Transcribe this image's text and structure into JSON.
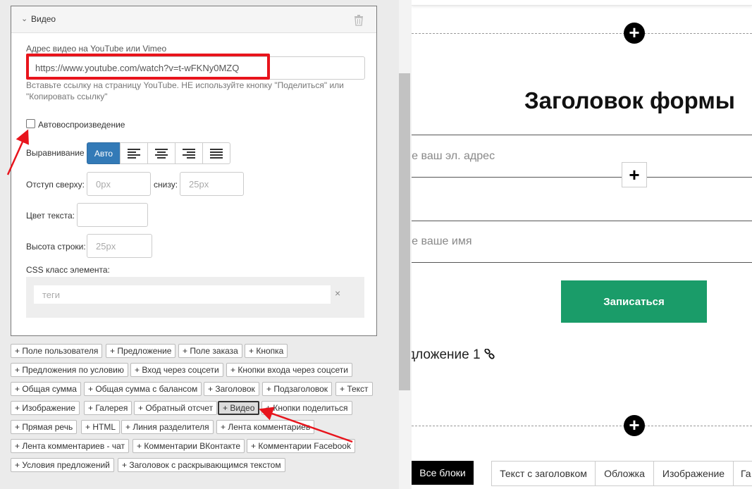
{
  "panel": {
    "card_title": "Видео",
    "url_label": "Адрес видео на YouTube или Vimeo",
    "url_value": "https://www.youtube.com/watch?v=t-wFKNy0MZQ",
    "url_hint_line1": "Вставьте ссылку на страницу YouTube. НЕ используйте кнопку \"Поделиться\" или",
    "url_hint_line2": "\"Копировать ссылку\"",
    "autoplay_label": "Автовоспроизведение",
    "align_label": "Выравнивание",
    "align_auto": "Авто",
    "margin_top_label": "Отступ сверху:",
    "margin_top_placeholder": "0px",
    "margin_bottom_label": "снизу:",
    "margin_bottom_placeholder": "25px",
    "text_color_label": "Цвет текста:",
    "line_height_label": "Высота строки:",
    "line_height_placeholder": "25px",
    "css_class_label": "CSS класс элемента:",
    "tags_placeholder": "теги",
    "tags_clear": "×"
  },
  "chips": [
    "+ Поле пользователя",
    "+ Предложение",
    "+ Поле заказа",
    "+ Кнопка",
    "+ Предложения по условию",
    "+ Вход через соцсети",
    "+ Кнопки входа через соцсети",
    "+ Общая сумма",
    "+ Общая сумма с балансом",
    "+ Заголовок",
    "+ Подзаголовок",
    "+ Текст",
    "+ Изображение",
    "+ Галерея",
    "+ Обратный отсчет",
    "+ Видео",
    "+ Кнопки поделиться",
    "+ Прямая речь",
    "+ HTML",
    "+ Линия разделителя",
    "+ Лента комментариев",
    "+ Лента комментариев - чат",
    "+ Комментарии ВКонтакте",
    "+ Комментарии Facebook",
    "+ Условия предложений",
    "+ Заголовок с раскрывающимся текстом"
  ],
  "preview": {
    "form_title": "Заголовок формы",
    "email_placeholder": "те ваш эл. адрес",
    "name_placeholder": "те ваше имя",
    "submit_label": "Записаться",
    "offer_text": "дложение 1",
    "plus": "+"
  },
  "bottom_tabs": {
    "all_blocks": "Все блоки",
    "tabs": [
      "Текст с заголовком",
      "Обложка",
      "Изображение",
      "Га"
    ]
  },
  "colors": {
    "highlight_red": "#e8141c",
    "primary_blue": "#337ab7",
    "submit_green": "#1a9c69"
  }
}
